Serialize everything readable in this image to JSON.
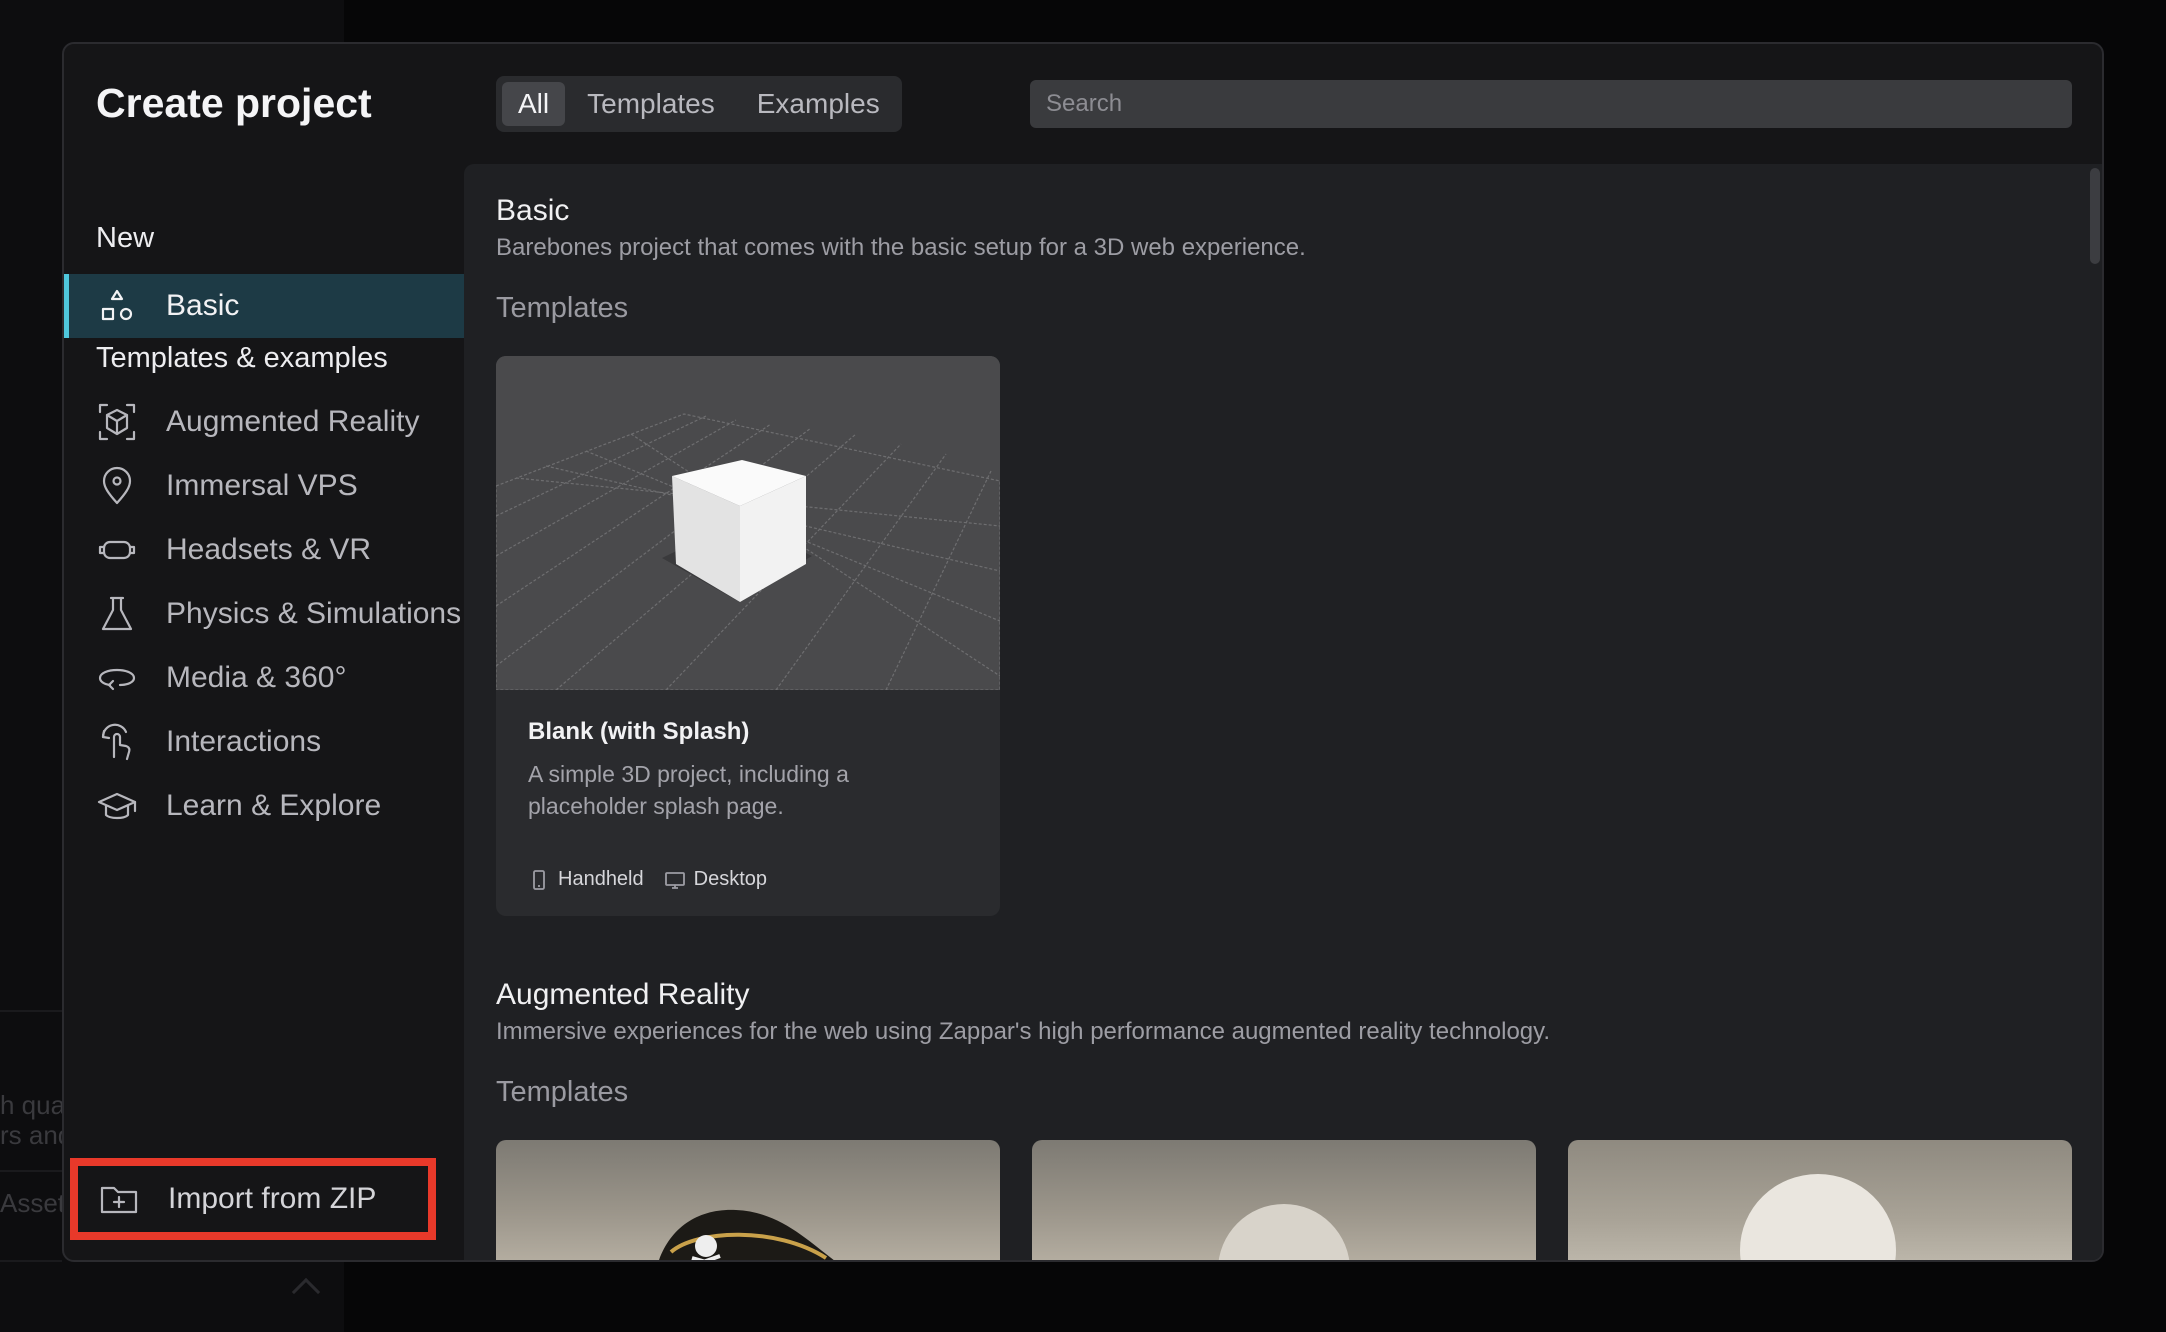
{
  "modal": {
    "title": "Create project",
    "tabs": [
      {
        "label": "All",
        "active": true
      },
      {
        "label": "Templates",
        "active": false
      },
      {
        "label": "Examples",
        "active": false
      }
    ],
    "search": {
      "placeholder": "Search",
      "value": ""
    }
  },
  "sidebar": {
    "new_label": "New",
    "new_items": [
      {
        "label": "Basic",
        "icon": "shapes-icon",
        "active": true
      }
    ],
    "templates_label": "Templates & examples",
    "items": [
      {
        "label": "Augmented Reality",
        "icon": "ar-cube-icon"
      },
      {
        "label": "Immersal VPS",
        "icon": "map-pin-icon"
      },
      {
        "label": "Headsets & VR",
        "icon": "vr-headset-icon"
      },
      {
        "label": "Physics & Simulations",
        "icon": "flask-icon"
      },
      {
        "label": "Media & 360°",
        "icon": "rotate-360-icon"
      },
      {
        "label": "Interactions",
        "icon": "tap-gesture-icon"
      },
      {
        "label": "Learn & Explore",
        "icon": "graduation-cap-icon"
      }
    ],
    "import_label": "Import from ZIP",
    "import_icon": "folder-plus-icon",
    "highlight_color": "#e8392a"
  },
  "content": {
    "sections": [
      {
        "title": "Basic",
        "description": "Barebones project that comes with the basic setup for a 3D web experience.",
        "subheading": "Templates",
        "cards": [
          {
            "name": "Blank (with Splash)",
            "description": "A simple 3D project, including a placeholder splash page.",
            "tags": [
              {
                "label": "Handheld",
                "icon": "phone-icon"
              },
              {
                "label": "Desktop",
                "icon": "monitor-icon"
              }
            ]
          }
        ]
      },
      {
        "title": "Augmented Reality",
        "description": "Immersive experiences for the web using Zappar's high performance augmented reality technology.",
        "subheading": "Templates"
      }
    ]
  },
  "backdrop": {
    "fragments": [
      "h qual",
      "rs and",
      "Asset"
    ]
  },
  "colors": {
    "accent": "#4fc7dc",
    "active_bg": "#1d3a45"
  }
}
